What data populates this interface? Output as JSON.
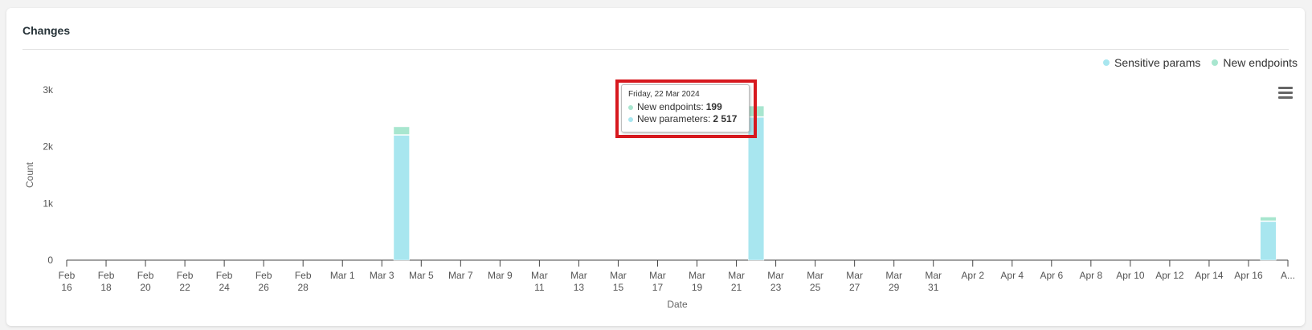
{
  "card": {
    "title": "Changes"
  },
  "legend": [
    {
      "label": "Sensitive params",
      "color": "#a8e6ef"
    },
    {
      "label": "New endpoints",
      "color": "#a8e6cf"
    }
  ],
  "tooltip": {
    "date": "Friday, 22 Mar 2024",
    "rows": [
      {
        "label": "New endpoints: ",
        "value": "199",
        "color": "#a8e6cf"
      },
      {
        "label": "New parameters: ",
        "value": "2 517",
        "color": "#a8e6ef"
      }
    ]
  },
  "menu": {
    "icon": "hamburger-menu-icon"
  },
  "chart_data": {
    "type": "bar",
    "stacked": true,
    "xlabel": "Date",
    "ylabel": "Count",
    "ylim": [
      0,
      3000
    ],
    "yticks": [
      {
        "value": 0,
        "label": "0"
      },
      {
        "value": 1000,
        "label": "1k"
      },
      {
        "value": 2000,
        "label": "2k"
      },
      {
        "value": 3000,
        "label": "3k"
      }
    ],
    "x_start": "2024-02-16",
    "x_end": "2024-04-18",
    "xticks": [
      {
        "date": "2024-02-16",
        "label": [
          "Feb",
          "16"
        ]
      },
      {
        "date": "2024-02-18",
        "label": [
          "Feb",
          "18"
        ]
      },
      {
        "date": "2024-02-20",
        "label": [
          "Feb",
          "20"
        ]
      },
      {
        "date": "2024-02-22",
        "label": [
          "Feb",
          "22"
        ]
      },
      {
        "date": "2024-02-24",
        "label": [
          "Feb",
          "24"
        ]
      },
      {
        "date": "2024-02-26",
        "label": [
          "Feb",
          "26"
        ]
      },
      {
        "date": "2024-02-28",
        "label": [
          "Feb",
          "28"
        ]
      },
      {
        "date": "2024-03-01",
        "label": [
          "Mar 1"
        ]
      },
      {
        "date": "2024-03-03",
        "label": [
          "Mar 3"
        ]
      },
      {
        "date": "2024-03-05",
        "label": [
          "Mar 5"
        ]
      },
      {
        "date": "2024-03-07",
        "label": [
          "Mar 7"
        ]
      },
      {
        "date": "2024-03-09",
        "label": [
          "Mar 9"
        ]
      },
      {
        "date": "2024-03-11",
        "label": [
          "Mar",
          "11"
        ]
      },
      {
        "date": "2024-03-13",
        "label": [
          "Mar",
          "13"
        ]
      },
      {
        "date": "2024-03-15",
        "label": [
          "Mar",
          "15"
        ]
      },
      {
        "date": "2024-03-17",
        "label": [
          "Mar",
          "17"
        ]
      },
      {
        "date": "2024-03-19",
        "label": [
          "Mar",
          "19"
        ]
      },
      {
        "date": "2024-03-21",
        "label": [
          "Mar",
          "21"
        ]
      },
      {
        "date": "2024-03-23",
        "label": [
          "Mar",
          "23"
        ]
      },
      {
        "date": "2024-03-25",
        "label": [
          "Mar",
          "25"
        ]
      },
      {
        "date": "2024-03-27",
        "label": [
          "Mar",
          "27"
        ]
      },
      {
        "date": "2024-03-29",
        "label": [
          "Mar",
          "29"
        ]
      },
      {
        "date": "2024-03-31",
        "label": [
          "Mar",
          "31"
        ]
      },
      {
        "date": "2024-04-02",
        "label": [
          "Apr 2"
        ]
      },
      {
        "date": "2024-04-04",
        "label": [
          "Apr 4"
        ]
      },
      {
        "date": "2024-04-06",
        "label": [
          "Apr 6"
        ]
      },
      {
        "date": "2024-04-08",
        "label": [
          "Apr 8"
        ]
      },
      {
        "date": "2024-04-10",
        "label": [
          "Apr 10"
        ]
      },
      {
        "date": "2024-04-12",
        "label": [
          "Apr 12"
        ]
      },
      {
        "date": "2024-04-14",
        "label": [
          "Apr 14"
        ]
      },
      {
        "date": "2024-04-16",
        "label": [
          "Apr 16"
        ]
      },
      {
        "date": "2024-04-18",
        "label": [
          "A..."
        ]
      }
    ],
    "series": [
      {
        "name": "Sensitive params",
        "color": "#a8e6ef",
        "points": [
          {
            "date": "2024-03-04",
            "value": 2200
          },
          {
            "date": "2024-03-22",
            "value": 2517
          },
          {
            "date": "2024-04-17",
            "value": 680
          }
        ]
      },
      {
        "name": "New endpoints",
        "color": "#a8e6cf",
        "points": [
          {
            "date": "2024-03-04",
            "value": 150
          },
          {
            "date": "2024-03-22",
            "value": 199
          },
          {
            "date": "2024-04-17",
            "value": 80
          }
        ]
      }
    ]
  }
}
